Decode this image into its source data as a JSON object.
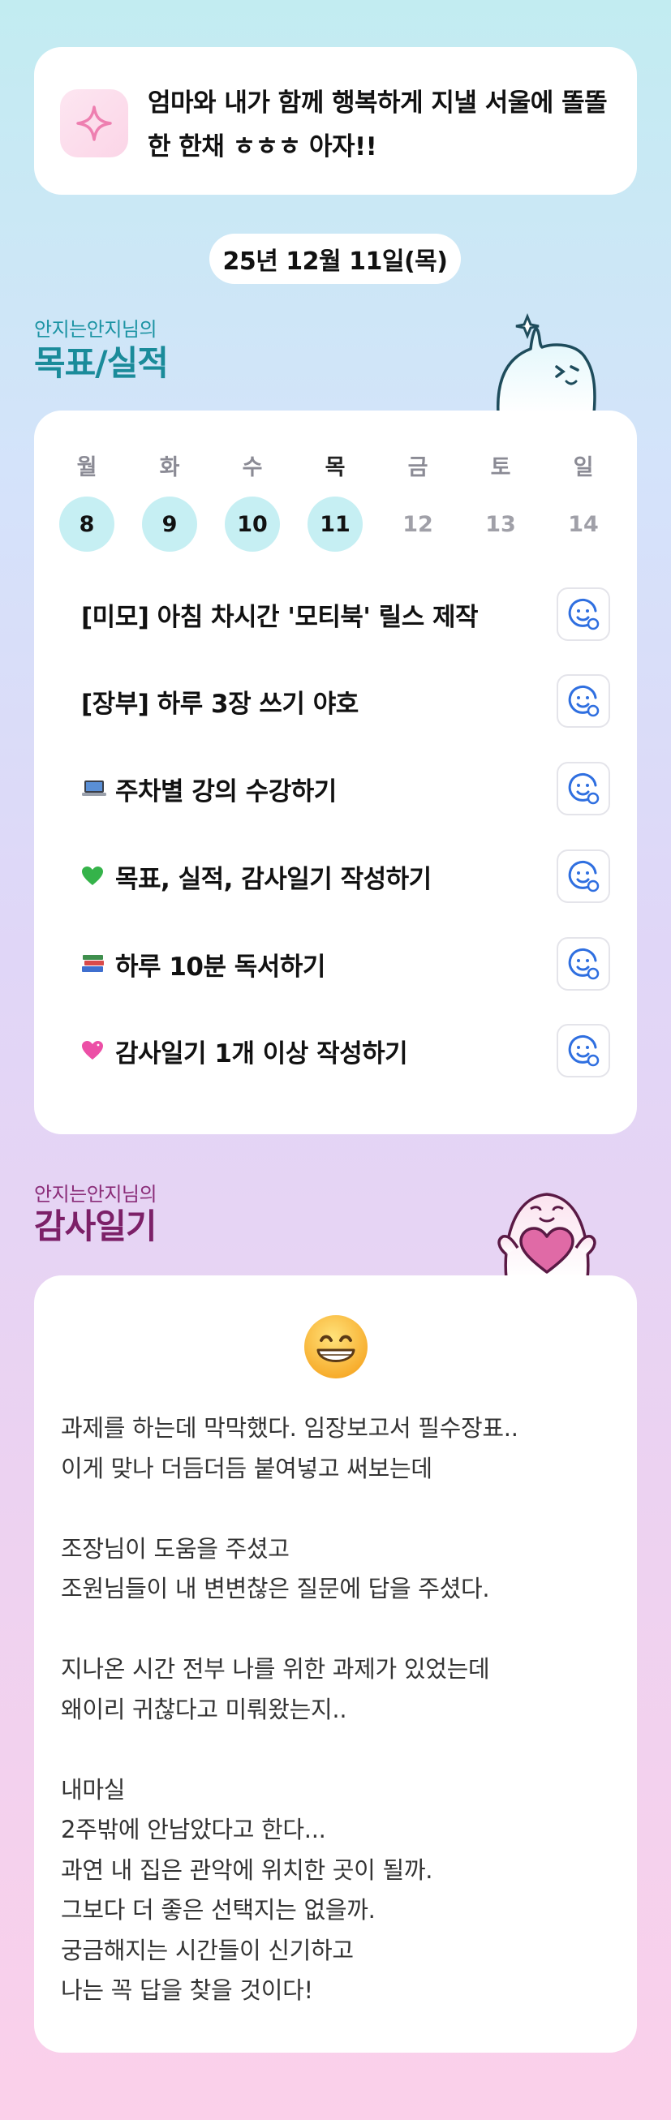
{
  "goal": {
    "icon": "sparkle-icon",
    "text": "엄마와 내가 함께 행복하게 지낼 서울에 똘똘한 한채 ㅎㅎㅎ 아자!!"
  },
  "date": "25년 12월 11일(목)",
  "goals_section": {
    "subtitle": "안지는안지님의",
    "title": "목표/실적"
  },
  "week": {
    "days": [
      {
        "dow": "월",
        "date": "8",
        "done": true
      },
      {
        "dow": "화",
        "date": "9",
        "done": true
      },
      {
        "dow": "수",
        "date": "10",
        "done": true
      },
      {
        "dow": "목",
        "date": "11",
        "done": true,
        "today": true
      },
      {
        "dow": "금",
        "date": "12",
        "done": false
      },
      {
        "dow": "토",
        "date": "13",
        "done": false
      },
      {
        "dow": "일",
        "date": "14",
        "done": false
      }
    ]
  },
  "tasks": [
    {
      "emoji": "",
      "label": "[미모] 아침 차시간 '모티북' 릴스 제작"
    },
    {
      "emoji": "laptop-icon",
      "label": "[장부] 하루 3장 쓰기 야호"
    },
    {
      "emoji": "laptop-icon",
      "label": "주차별 강의 수강하기"
    },
    {
      "emoji": "green-heart-icon",
      "label": "목표, 실적, 감사일기 작성하기"
    },
    {
      "emoji": "books-icon",
      "label": "하루 10분 독서하기"
    },
    {
      "emoji": "pink-heart-icon",
      "label": "감사일기 1개 이상 작성하기"
    }
  ],
  "diary_section": {
    "subtitle": "안지는안지님의",
    "title": "감사일기"
  },
  "diary": {
    "mood_icon": "grinning-face-icon",
    "text": "과제를 하는데 막막했다. 임장보고서 필수장표..\n이게 맞나 더듬더듬 붙여넣고 써보는데\n\n조장님이 도움을 주셨고\n조원님들이 내 변변찮은 질문에 답을 주셨다.\n\n지나온 시간 전부 나를 위한 과제가 있었는데\n왜이리 귀찮다고 미뤄왔는지..\n\n내마실\n2주밖에 안남았다고 한다...\n과연 내 집은 관악에 위치한 곳이 될까.\n그보다 더 좋은 선택지는 없을까.\n궁금해지는 시간들이 신기하고\n나는 꼭 답을 찾을 것이다!"
  },
  "colors": {
    "goals_accent": "#1a8b9a",
    "diary_accent": "#7c2068",
    "done_day": "#c6eff3",
    "face_icon": "#2f6fe0"
  }
}
